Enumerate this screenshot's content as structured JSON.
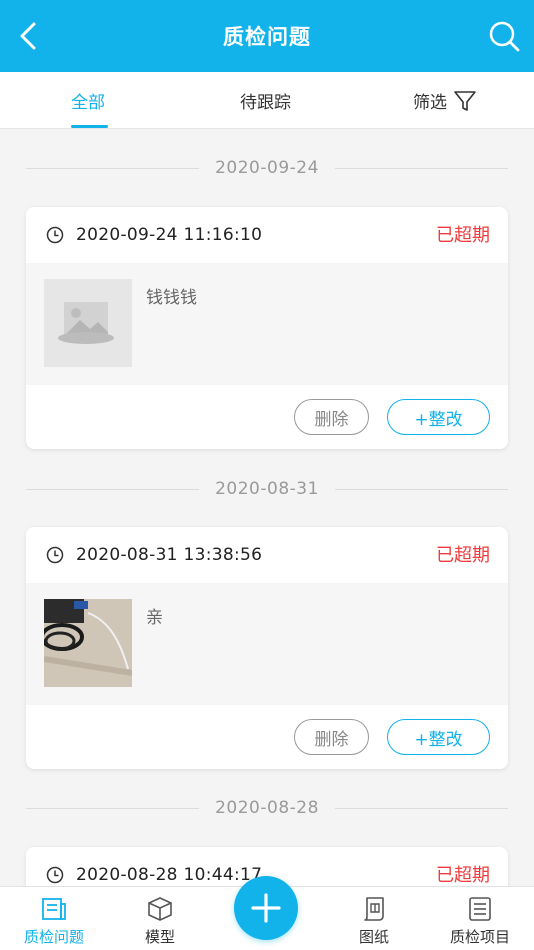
{
  "header": {
    "title": "质检问题",
    "back_icon": "chevron-left-icon",
    "search_icon": "search-icon"
  },
  "tabs": [
    {
      "label": "全部",
      "active": true
    },
    {
      "label": "待跟踪",
      "active": false
    },
    {
      "label": "筛选",
      "active": false,
      "icon": "filter-icon"
    }
  ],
  "groups": [
    {
      "date": "2020-09-24",
      "card": {
        "time": "2020-09-24 11:16:10",
        "status": "已超期",
        "description": "钱钱钱",
        "thumbnail": "image-placeholder-icon",
        "delete_label": "删除",
        "fix_label": "+整改"
      }
    },
    {
      "date": "2020-08-31",
      "card": {
        "time": "2020-08-31 13:38:56",
        "status": "已超期",
        "description": "亲",
        "thumbnail": "photo-cables",
        "delete_label": "删除",
        "fix_label": "+整改"
      }
    },
    {
      "date": "2020-08-28",
      "card": {
        "time": "2020-08-28 10:44:17",
        "status": "已超期"
      }
    }
  ],
  "bottom_nav": [
    {
      "label": "质检问题",
      "icon": "document-list-icon",
      "active": true
    },
    {
      "label": "模型",
      "icon": "cube-icon",
      "active": false
    },
    {
      "label": "图纸",
      "icon": "drawing-scroll-icon",
      "active": false
    },
    {
      "label": "质检项目",
      "icon": "checklist-icon",
      "active": false
    }
  ],
  "fab": {
    "icon": "plus-icon"
  },
  "colors": {
    "primary": "#12b2ea",
    "overdue": "#ee3b3b",
    "background": "#f4f4f4"
  }
}
